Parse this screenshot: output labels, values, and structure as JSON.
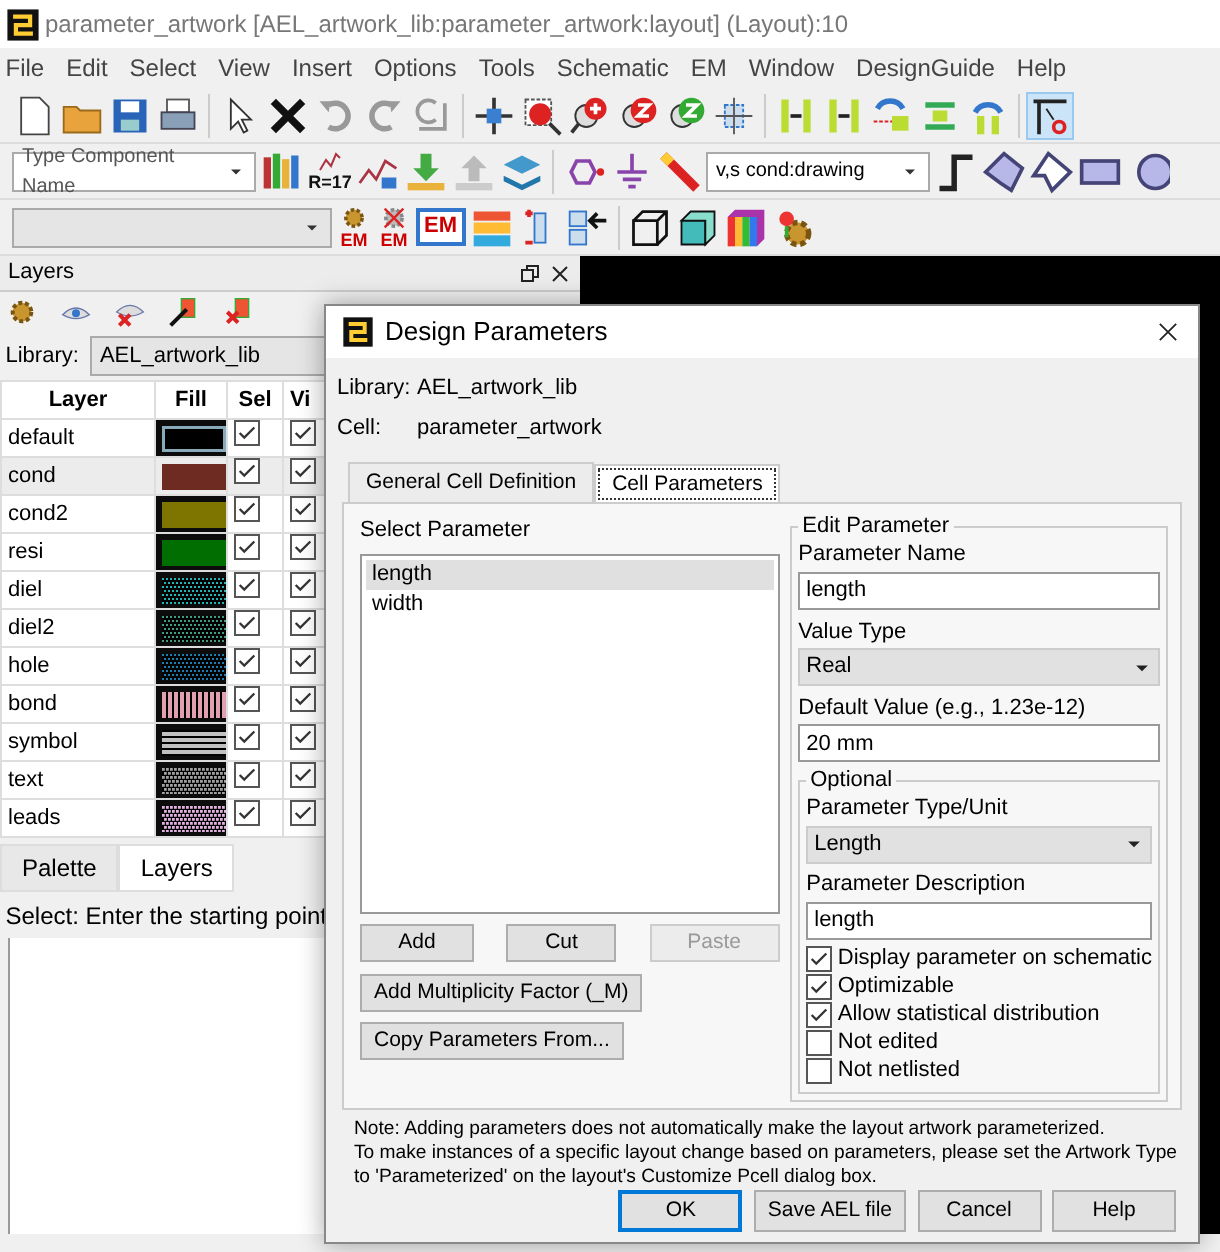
{
  "window": {
    "title": "parameter_artwork [AEL_artwork_lib:parameter_artwork:layout] (Layout):10"
  },
  "menu": [
    "File",
    "Edit",
    "Select",
    "View",
    "Insert",
    "Options",
    "Tools",
    "Schematic",
    "EM",
    "Window",
    "DesignGuide",
    "Help"
  ],
  "toolbars": [
    [
      {
        "kind": "new",
        "pressed": false
      },
      {
        "kind": "open",
        "pressed": false
      },
      {
        "kind": "save",
        "pressed": false
      },
      {
        "kind": "print",
        "pressed": false
      },
      {
        "kind": "sep"
      },
      {
        "kind": "pointer",
        "pressed": false
      },
      {
        "kind": "delete",
        "pressed": false
      },
      {
        "kind": "undo",
        "pressed": false
      },
      {
        "kind": "redo",
        "pressed": false
      },
      {
        "kind": "repeat",
        "pressed": false
      },
      {
        "kind": "sep"
      },
      {
        "kind": "pan",
        "pressed": false
      },
      {
        "kind": "zoombox",
        "pressed": false
      },
      {
        "kind": "zoomin",
        "pressed": false
      },
      {
        "kind": "zoomin2",
        "pressed": false
      },
      {
        "kind": "zoomout",
        "pressed": false
      },
      {
        "kind": "snap",
        "pressed": false
      },
      {
        "kind": "sep"
      },
      {
        "kind": "align",
        "pressed": false
      },
      {
        "kind": "align",
        "pressed": false
      },
      {
        "kind": "swap",
        "pressed": false
      },
      {
        "kind": "spread",
        "pressed": false
      },
      {
        "kind": "rotate",
        "pressed": false
      },
      {
        "kind": "sep"
      },
      {
        "kind": "tool",
        "pressed": true
      }
    ],
    [
      {
        "kind": "combo",
        "placeholder": "Type Component Name"
      },
      {
        "kind": "books"
      },
      {
        "kind": "label",
        "label": "R=17"
      },
      {
        "kind": "wave"
      },
      {
        "kind": "down"
      },
      {
        "kind": "up"
      },
      {
        "kind": "stack"
      },
      {
        "kind": "sep"
      },
      {
        "kind": "hex"
      },
      {
        "kind": "ground"
      },
      {
        "kind": "pencil"
      },
      {
        "kind": "combo",
        "value": "v,s cond:drawing"
      },
      {
        "kind": "step"
      },
      {
        "kind": "poly"
      },
      {
        "kind": "poly2"
      },
      {
        "kind": "rect"
      },
      {
        "kind": "circle"
      }
    ],
    [
      {
        "kind": "combo"
      },
      {
        "kind": "gearem",
        "label": "EM"
      },
      {
        "kind": "gearemx",
        "label": "EM"
      },
      {
        "kind": "embox",
        "label": "EM"
      },
      {
        "kind": "bars"
      },
      {
        "kind": "comp"
      },
      {
        "kind": "insert"
      },
      {
        "kind": "sep"
      },
      {
        "kind": "cube"
      },
      {
        "kind": "cube2"
      },
      {
        "kind": "rainbow"
      },
      {
        "kind": "gear2"
      }
    ]
  ],
  "layers_panel": {
    "title": "Layers",
    "library_label": "Library:",
    "library": "AEL_artwork_lib",
    "columns": [
      "Layer",
      "Fill",
      "Sel",
      "Vi"
    ],
    "rows": [
      {
        "name": "default",
        "color": "#000000",
        "kind": "outline",
        "selected": false,
        "sel": true,
        "vis": true
      },
      {
        "name": "cond",
        "color": "#6e2b22",
        "kind": "solid",
        "selected": true,
        "sel": true,
        "vis": true
      },
      {
        "name": "cond2",
        "color": "#7d7500",
        "kind": "solid",
        "selected": false,
        "sel": true,
        "vis": true
      },
      {
        "name": "resi",
        "color": "#006e00",
        "kind": "solid",
        "selected": false,
        "sel": true,
        "vis": true
      },
      {
        "name": "diel",
        "color": "#1fb5b5",
        "kind": "dots",
        "selected": false,
        "sel": true,
        "vis": true
      },
      {
        "name": "diel2",
        "color": "#3f9c80",
        "kind": "dots",
        "selected": false,
        "sel": true,
        "vis": true
      },
      {
        "name": "hole",
        "color": "#1a7fb0",
        "kind": "dots",
        "selected": false,
        "sel": true,
        "vis": true
      },
      {
        "name": "bond",
        "color": "#e0a0b0",
        "kind": "vstripes",
        "selected": false,
        "sel": true,
        "vis": true
      },
      {
        "name": "symbol",
        "color": "#c0c0c0",
        "kind": "hlines",
        "selected": false,
        "sel": true,
        "vis": true
      },
      {
        "name": "text",
        "color": "#a0a0a0",
        "kind": "checker",
        "selected": false,
        "sel": true,
        "vis": true
      },
      {
        "name": "leads",
        "color": "#e0b0e0",
        "kind": "checker",
        "selected": false,
        "sel": true,
        "vis": true
      }
    ],
    "tabs": [
      {
        "label": "Palette",
        "selected": false
      },
      {
        "label": "Layers",
        "selected": true
      }
    ],
    "status": "Select: Enter the starting point"
  },
  "dialog": {
    "title": "Design Parameters",
    "library_label": "Library:",
    "library": "AEL_artwork_lib",
    "cell_label": "Cell:",
    "cell": "parameter_artwork",
    "tabs": [
      {
        "label": "General Cell Definition",
        "selected": false
      },
      {
        "label": "Cell Parameters",
        "selected": true
      }
    ],
    "select_label": "Select Parameter",
    "parameters": [
      {
        "name": "length",
        "selected": true
      },
      {
        "name": "width",
        "selected": false
      }
    ],
    "list_buttons": [
      {
        "label": "Add",
        "disabled": false
      },
      {
        "label": "Cut",
        "disabled": false
      },
      {
        "label": "Paste",
        "disabled": true
      }
    ],
    "extra_buttons": [
      "Add Multiplicity Factor (_M)",
      "Copy Parameters From..."
    ],
    "edit": {
      "title": "Edit Parameter",
      "name_label": "Parameter Name",
      "name": "length",
      "type_label": "Value Type",
      "type": "Real",
      "default_label": "Default Value (e.g., 1.23e-12)",
      "default": "20 mm",
      "optional": {
        "title": "Optional",
        "unit_label": "Parameter Type/Unit",
        "unit": "Length",
        "desc_label": "Parameter Description",
        "desc": "length",
        "checks": [
          {
            "label": "Display parameter on schematic",
            "checked": true
          },
          {
            "label": "Optimizable",
            "checked": true
          },
          {
            "label": "Allow statistical distribution",
            "checked": true
          },
          {
            "label": "Not edited",
            "checked": false
          },
          {
            "label": "Not netlisted",
            "checked": false
          }
        ]
      }
    },
    "note": "Note: Adding parameters does not automatically make the layout artwork parameterized.\nTo make instances of a specific layout change based on parameters, please set the Artwork Type\nto 'Parameterized' on the layout's Customize Pcell dialog box.",
    "footer": [
      {
        "label": "OK",
        "default": true
      },
      {
        "label": "Save AEL file",
        "default": false
      },
      {
        "label": "Cancel",
        "default": false
      },
      {
        "label": "Help",
        "default": false
      }
    ]
  }
}
